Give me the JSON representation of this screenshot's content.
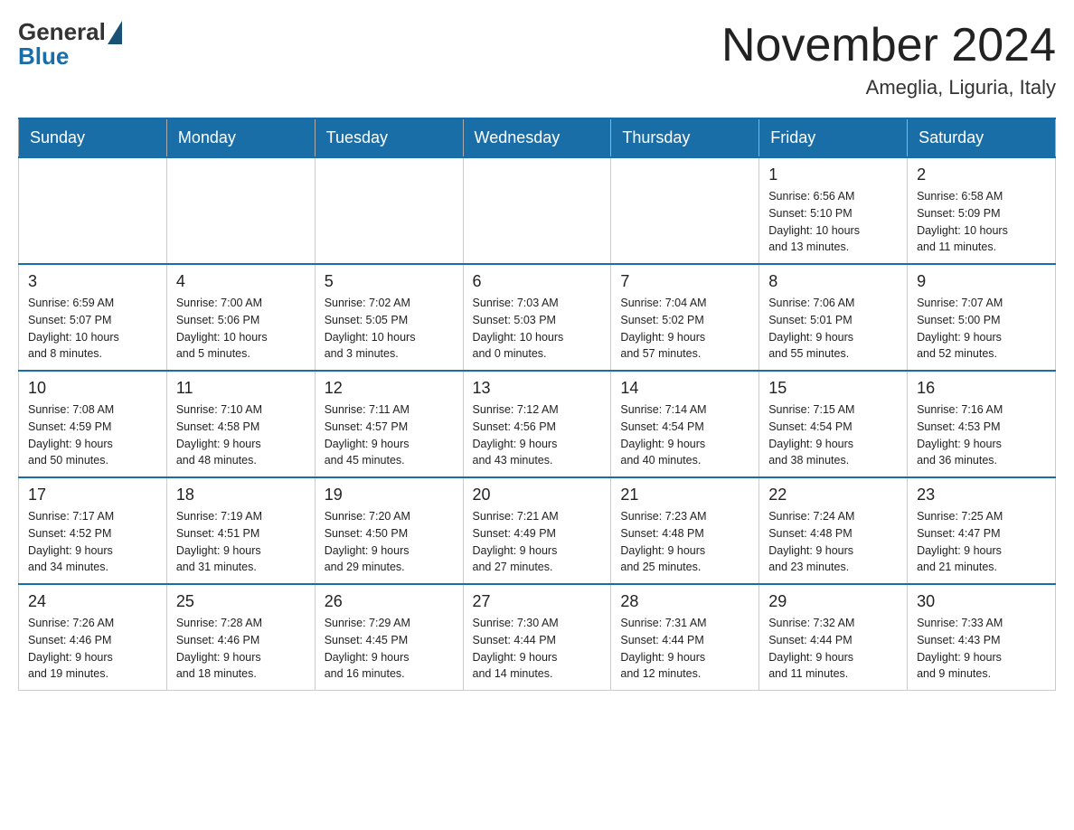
{
  "header": {
    "logo_general": "General",
    "logo_blue": "Blue",
    "title": "November 2024",
    "subtitle": "Ameglia, Liguria, Italy"
  },
  "weekdays": [
    "Sunday",
    "Monday",
    "Tuesday",
    "Wednesday",
    "Thursday",
    "Friday",
    "Saturday"
  ],
  "weeks": [
    [
      {
        "day": "",
        "info": ""
      },
      {
        "day": "",
        "info": ""
      },
      {
        "day": "",
        "info": ""
      },
      {
        "day": "",
        "info": ""
      },
      {
        "day": "",
        "info": ""
      },
      {
        "day": "1",
        "info": "Sunrise: 6:56 AM\nSunset: 5:10 PM\nDaylight: 10 hours\nand 13 minutes."
      },
      {
        "day": "2",
        "info": "Sunrise: 6:58 AM\nSunset: 5:09 PM\nDaylight: 10 hours\nand 11 minutes."
      }
    ],
    [
      {
        "day": "3",
        "info": "Sunrise: 6:59 AM\nSunset: 5:07 PM\nDaylight: 10 hours\nand 8 minutes."
      },
      {
        "day": "4",
        "info": "Sunrise: 7:00 AM\nSunset: 5:06 PM\nDaylight: 10 hours\nand 5 minutes."
      },
      {
        "day": "5",
        "info": "Sunrise: 7:02 AM\nSunset: 5:05 PM\nDaylight: 10 hours\nand 3 minutes."
      },
      {
        "day": "6",
        "info": "Sunrise: 7:03 AM\nSunset: 5:03 PM\nDaylight: 10 hours\nand 0 minutes."
      },
      {
        "day": "7",
        "info": "Sunrise: 7:04 AM\nSunset: 5:02 PM\nDaylight: 9 hours\nand 57 minutes."
      },
      {
        "day": "8",
        "info": "Sunrise: 7:06 AM\nSunset: 5:01 PM\nDaylight: 9 hours\nand 55 minutes."
      },
      {
        "day": "9",
        "info": "Sunrise: 7:07 AM\nSunset: 5:00 PM\nDaylight: 9 hours\nand 52 minutes."
      }
    ],
    [
      {
        "day": "10",
        "info": "Sunrise: 7:08 AM\nSunset: 4:59 PM\nDaylight: 9 hours\nand 50 minutes."
      },
      {
        "day": "11",
        "info": "Sunrise: 7:10 AM\nSunset: 4:58 PM\nDaylight: 9 hours\nand 48 minutes."
      },
      {
        "day": "12",
        "info": "Sunrise: 7:11 AM\nSunset: 4:57 PM\nDaylight: 9 hours\nand 45 minutes."
      },
      {
        "day": "13",
        "info": "Sunrise: 7:12 AM\nSunset: 4:56 PM\nDaylight: 9 hours\nand 43 minutes."
      },
      {
        "day": "14",
        "info": "Sunrise: 7:14 AM\nSunset: 4:54 PM\nDaylight: 9 hours\nand 40 minutes."
      },
      {
        "day": "15",
        "info": "Sunrise: 7:15 AM\nSunset: 4:54 PM\nDaylight: 9 hours\nand 38 minutes."
      },
      {
        "day": "16",
        "info": "Sunrise: 7:16 AM\nSunset: 4:53 PM\nDaylight: 9 hours\nand 36 minutes."
      }
    ],
    [
      {
        "day": "17",
        "info": "Sunrise: 7:17 AM\nSunset: 4:52 PM\nDaylight: 9 hours\nand 34 minutes."
      },
      {
        "day": "18",
        "info": "Sunrise: 7:19 AM\nSunset: 4:51 PM\nDaylight: 9 hours\nand 31 minutes."
      },
      {
        "day": "19",
        "info": "Sunrise: 7:20 AM\nSunset: 4:50 PM\nDaylight: 9 hours\nand 29 minutes."
      },
      {
        "day": "20",
        "info": "Sunrise: 7:21 AM\nSunset: 4:49 PM\nDaylight: 9 hours\nand 27 minutes."
      },
      {
        "day": "21",
        "info": "Sunrise: 7:23 AM\nSunset: 4:48 PM\nDaylight: 9 hours\nand 25 minutes."
      },
      {
        "day": "22",
        "info": "Sunrise: 7:24 AM\nSunset: 4:48 PM\nDaylight: 9 hours\nand 23 minutes."
      },
      {
        "day": "23",
        "info": "Sunrise: 7:25 AM\nSunset: 4:47 PM\nDaylight: 9 hours\nand 21 minutes."
      }
    ],
    [
      {
        "day": "24",
        "info": "Sunrise: 7:26 AM\nSunset: 4:46 PM\nDaylight: 9 hours\nand 19 minutes."
      },
      {
        "day": "25",
        "info": "Sunrise: 7:28 AM\nSunset: 4:46 PM\nDaylight: 9 hours\nand 18 minutes."
      },
      {
        "day": "26",
        "info": "Sunrise: 7:29 AM\nSunset: 4:45 PM\nDaylight: 9 hours\nand 16 minutes."
      },
      {
        "day": "27",
        "info": "Sunrise: 7:30 AM\nSunset: 4:44 PM\nDaylight: 9 hours\nand 14 minutes."
      },
      {
        "day": "28",
        "info": "Sunrise: 7:31 AM\nSunset: 4:44 PM\nDaylight: 9 hours\nand 12 minutes."
      },
      {
        "day": "29",
        "info": "Sunrise: 7:32 AM\nSunset: 4:44 PM\nDaylight: 9 hours\nand 11 minutes."
      },
      {
        "day": "30",
        "info": "Sunrise: 7:33 AM\nSunset: 4:43 PM\nDaylight: 9 hours\nand 9 minutes."
      }
    ]
  ]
}
